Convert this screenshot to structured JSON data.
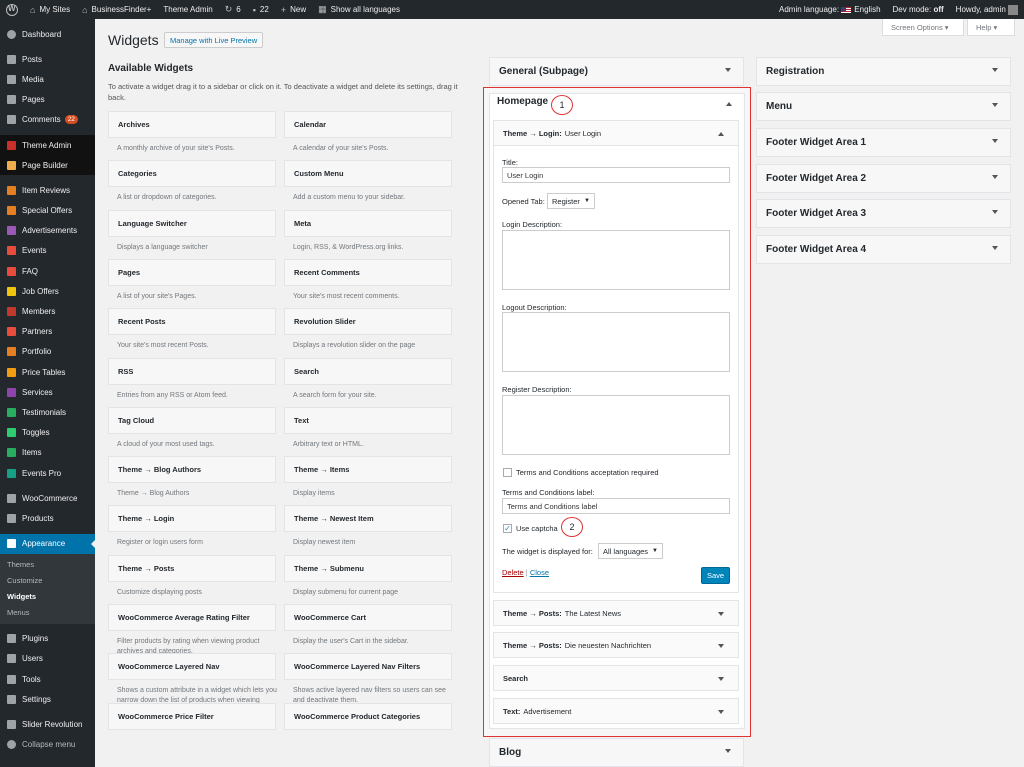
{
  "adminbar": {
    "my_sites": "My Sites",
    "site_name": "BusinessFinder+",
    "theme_admin": "Theme Admin",
    "updates_count": "6",
    "comments_count": "22",
    "new": "New",
    "languages": "Show all languages",
    "admin_language_label": "Admin language:",
    "admin_language_value": "English",
    "dev_mode_label": "Dev mode:",
    "dev_mode_value": "off",
    "howdy": "Howdy, admin"
  },
  "menu": {
    "dashboard": "Dashboard",
    "posts": "Posts",
    "media": "Media",
    "pages": "Pages",
    "comments": "Comments",
    "comments_badge": "22",
    "theme_admin": "Theme Admin",
    "page_builder": "Page Builder",
    "item_reviews": "Item Reviews",
    "special_offers": "Special Offers",
    "advertisements": "Advertisements",
    "events": "Events",
    "faq": "FAQ",
    "job_offers": "Job Offers",
    "members": "Members",
    "partners": "Partners",
    "portfolio": "Portfolio",
    "price_tables": "Price Tables",
    "services": "Services",
    "testimonials": "Testimonials",
    "toggles": "Toggles",
    "items": "Items",
    "events_pro": "Events Pro",
    "woocommerce": "WooCommerce",
    "products": "Products",
    "appearance": "Appearance",
    "sub_themes": "Themes",
    "sub_customize": "Customize",
    "sub_widgets": "Widgets",
    "sub_menus": "Menus",
    "plugins": "Plugins",
    "users": "Users",
    "tools": "Tools",
    "settings": "Settings",
    "slider_revolution": "Slider Revolution",
    "collapse": "Collapse menu"
  },
  "header": {
    "title": "Widgets",
    "live_preview": "Manage with Live Preview",
    "screen_options": "Screen Options",
    "help": "Help"
  },
  "available": {
    "title": "Available Widgets",
    "description": "To activate a widget drag it to a sidebar or click on it. To deactivate a widget and delete its settings, drag it back.",
    "widgets": [
      {
        "name": "Archives",
        "desc": "A monthly archive of your site's Posts."
      },
      {
        "name": "Calendar",
        "desc": "A calendar of your site's Posts."
      },
      {
        "name": "Categories",
        "desc": "A list or dropdown of categories."
      },
      {
        "name": "Custom Menu",
        "desc": "Add a custom menu to your sidebar."
      },
      {
        "name": "Language Switcher",
        "desc": "Displays a language switcher"
      },
      {
        "name": "Meta",
        "desc": "Login, RSS, & WordPress.org links."
      },
      {
        "name": "Pages",
        "desc": "A list of your site's Pages."
      },
      {
        "name": "Recent Comments",
        "desc": "Your site's most recent comments."
      },
      {
        "name": "Recent Posts",
        "desc": "Your site's most recent Posts."
      },
      {
        "name": "Revolution Slider",
        "desc": "Displays a revolution slider on the page"
      },
      {
        "name": "RSS",
        "desc": "Entries from any RSS or Atom feed."
      },
      {
        "name": "Search",
        "desc": "A search form for your site."
      },
      {
        "name": "Tag Cloud",
        "desc": "A cloud of your most used tags."
      },
      {
        "name": "Text",
        "desc": "Arbitrary text or HTML."
      },
      {
        "name": "Theme → Blog Authors",
        "desc": "Theme → Blog Authors"
      },
      {
        "name": "Theme → Items",
        "desc": "Display items"
      },
      {
        "name": "Theme → Login",
        "desc": "Register or login users form"
      },
      {
        "name": "Theme → Newest Item",
        "desc": "Display newest item"
      },
      {
        "name": "Theme → Posts",
        "desc": "Customize displaying posts"
      },
      {
        "name": "Theme → Submenu",
        "desc": "Display submenu for current page"
      },
      {
        "name": "WooCommerce Average Rating Filter",
        "desc": "Filter products by rating when viewing product archives and categories."
      },
      {
        "name": "WooCommerce Cart",
        "desc": "Display the user's Cart in the sidebar."
      },
      {
        "name": "WooCommerce Layered Nav",
        "desc": "Shows a custom attribute in a widget which lets you narrow down the list of products when viewing product categories."
      },
      {
        "name": "WooCommerce Layered Nav Filters",
        "desc": "Shows active layered nav filters so users can see and deactivate them."
      },
      {
        "name": "WooCommerce Price Filter",
        "desc": ""
      },
      {
        "name": "WooCommerce Product Categories",
        "desc": ""
      }
    ]
  },
  "sidebars": {
    "general_subpage": "General (Subpage)",
    "homepage": "Homepage",
    "homepage_marker": "1",
    "blog": "Blog",
    "registration": "Registration",
    "menu": "Menu",
    "footer1": "Footer Widget Area 1",
    "footer2": "Footer Widget Area 2",
    "footer3": "Footer Widget Area 3",
    "footer4": "Footer Widget Area 4"
  },
  "login_widget": {
    "header_prefix": "Theme → Login:",
    "header_title": "User Login",
    "title_label": "Title:",
    "title_value": "User Login",
    "opened_tab_label": "Opened Tab:",
    "opened_tab_value": "Register",
    "login_desc_label": "Login Description:",
    "logout_desc_label": "Logout Description:",
    "register_desc_label": "Register Description:",
    "terms_checkbox_label": "Terms and Conditions acceptation required",
    "terms_label_label": "Terms and Conditions label:",
    "terms_label_value": "Terms and Conditions label",
    "captcha_label": "Use captcha",
    "captcha_marker": "2",
    "displayed_for_label": "The widget is displayed for:",
    "displayed_for_value": "All languages",
    "delete": "Delete",
    "separator": "|",
    "close": "Close",
    "save": "Save"
  },
  "homepage_widgets": [
    {
      "prefix": "Theme → Posts:",
      "title": "The Latest News"
    },
    {
      "prefix": "Theme → Posts:",
      "title": "Die neuesten Nachrichten"
    },
    {
      "prefix": "Search",
      "title": ""
    },
    {
      "prefix": "Text:",
      "title": "Advertisement"
    }
  ],
  "colors": {
    "accent": "#0073aa",
    "highlight_border": "#dd3333",
    "admin_bg": "#23282d"
  }
}
